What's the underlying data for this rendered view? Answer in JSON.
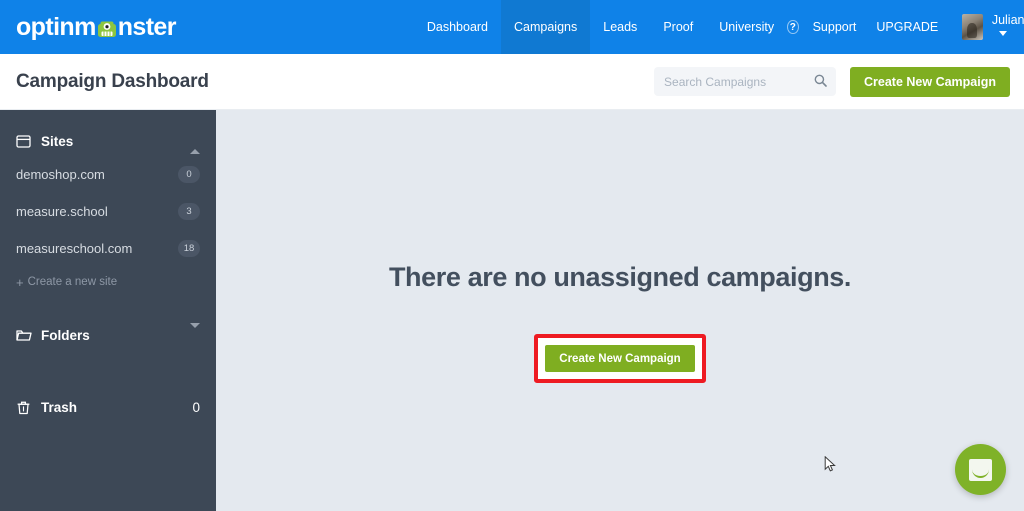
{
  "topnav": {
    "logo_text_before": "optinm",
    "logo_icon": "monster-mascot-icon",
    "logo_text_after": "nster",
    "logo_full": "optinmonster",
    "items": [
      {
        "label": "Dashboard",
        "active": false
      },
      {
        "label": "Campaigns",
        "active": true
      },
      {
        "label": "Leads",
        "active": false
      },
      {
        "label": "Proof",
        "active": false
      },
      {
        "label": "University",
        "active": false
      }
    ],
    "help_icon_label": "?",
    "support_label": "Support",
    "upgrade_label": "UPGRADE",
    "user_name": "Julian",
    "bg_color": "#0f82e8",
    "active_bg_color": "#1079d2"
  },
  "header": {
    "title": "Campaign Dashboard",
    "search": {
      "placeholder": "Search Campaigns",
      "value": ""
    },
    "create_button_label": "Create New Campaign",
    "create_button_color": "#7fae21"
  },
  "sidebar": {
    "bg_color": "#3d4856",
    "sites": {
      "label": "Sites",
      "icon": "window-icon",
      "expanded": true,
      "items": [
        {
          "label": "demoshop.com",
          "badge": "0"
        },
        {
          "label": "measure.school",
          "badge": "3"
        },
        {
          "label": "measureschool.com",
          "badge": "18"
        }
      ],
      "create_link": "Create a new site",
      "create_link_plus": "+"
    },
    "folders": {
      "label": "Folders",
      "icon": "folder-icon",
      "expanded": false
    },
    "trash": {
      "label": "Trash",
      "icon": "trash-icon",
      "badge": "0"
    }
  },
  "main": {
    "bg_color": "#e4e9ef",
    "empty_title": "There are no unassigned campaigns.",
    "cta_label": "Create New Campaign",
    "annotation_color": "#ee1b22"
  },
  "chat": {
    "icon": "chat-bubble-icon",
    "color": "#7fb228"
  }
}
